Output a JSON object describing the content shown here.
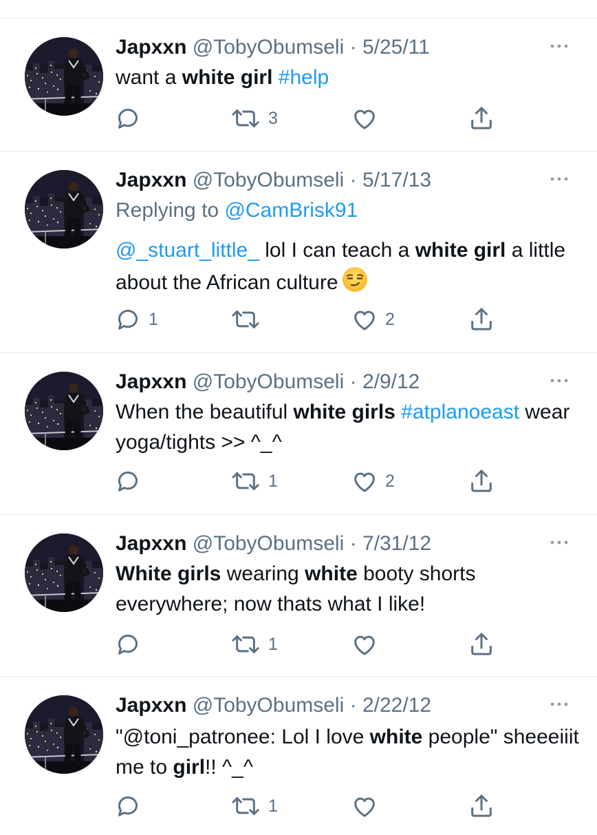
{
  "tweets": [
    {
      "name": "Japxxn",
      "handle": "@TobyObumseli",
      "separator": "·",
      "date": "5/25/11",
      "text": [
        {
          "t": "want a ",
          "b": false
        },
        {
          "t": "white girl",
          "b": true
        },
        {
          "t": " ",
          "b": false
        },
        {
          "t": "#help",
          "link": true
        }
      ],
      "counts": {
        "reply": "",
        "retweet": "3",
        "like": ""
      }
    },
    {
      "name": "Japxxn",
      "handle": "@TobyObumseli",
      "separator": "·",
      "date": "5/17/13",
      "replying_label": "Replying to",
      "replying_to": "@CamBrisk91",
      "text": [
        {
          "t": "@_stuart_little_",
          "link": true
        },
        {
          "t": " lol I can teach a ",
          "b": false
        },
        {
          "t": "white girl",
          "b": true
        },
        {
          "t": " a little about the African culture",
          "b": false
        },
        {
          "emoji": "smirk-emoji"
        }
      ],
      "counts": {
        "reply": "1",
        "retweet": "",
        "like": "2"
      }
    },
    {
      "name": "Japxxn",
      "handle": "@TobyObumseli",
      "separator": "·",
      "date": "2/9/12",
      "text": [
        {
          "t": "When the beautiful ",
          "b": false
        },
        {
          "t": "white girls",
          "b": true
        },
        {
          "t": " ",
          "b": false
        },
        {
          "t": "#atplanoeast",
          "link": true
        },
        {
          "t": " wear yoga/tights >> ^_^",
          "b": false
        }
      ],
      "counts": {
        "reply": "",
        "retweet": "1",
        "like": "2"
      }
    },
    {
      "name": "Japxxn",
      "handle": "@TobyObumseli",
      "separator": "·",
      "date": "7/31/12",
      "text": [
        {
          "t": "White girls",
          "b": true
        },
        {
          "t": " wearing ",
          "b": false
        },
        {
          "t": "white",
          "b": true
        },
        {
          "t": " booty shorts everywhere; now thats what I like!",
          "b": false
        }
      ],
      "counts": {
        "reply": "",
        "retweet": "1",
        "like": ""
      }
    },
    {
      "name": "Japxxn",
      "handle": "@TobyObumseli",
      "separator": "·",
      "date": "2/22/12",
      "text": [
        {
          "t": "\"@toni_patronee: Lol I love ",
          "b": false
        },
        {
          "t": "white",
          "b": true
        },
        {
          "t": " people\" sheeeiiit me to ",
          "b": false
        },
        {
          "t": "girl",
          "b": true
        },
        {
          "t": "!! ^_^",
          "b": false
        }
      ],
      "counts": {
        "reply": "",
        "retweet": "1",
        "like": ""
      }
    }
  ],
  "colors": {
    "text": "#0f1419",
    "muted": "#5b7083",
    "link": "#1d9bf0",
    "divider": "#e6e9ec"
  },
  "icons": [
    "more-icon",
    "reply-icon",
    "retweet-icon",
    "like-icon",
    "share-icon",
    "smirk-emoji"
  ]
}
